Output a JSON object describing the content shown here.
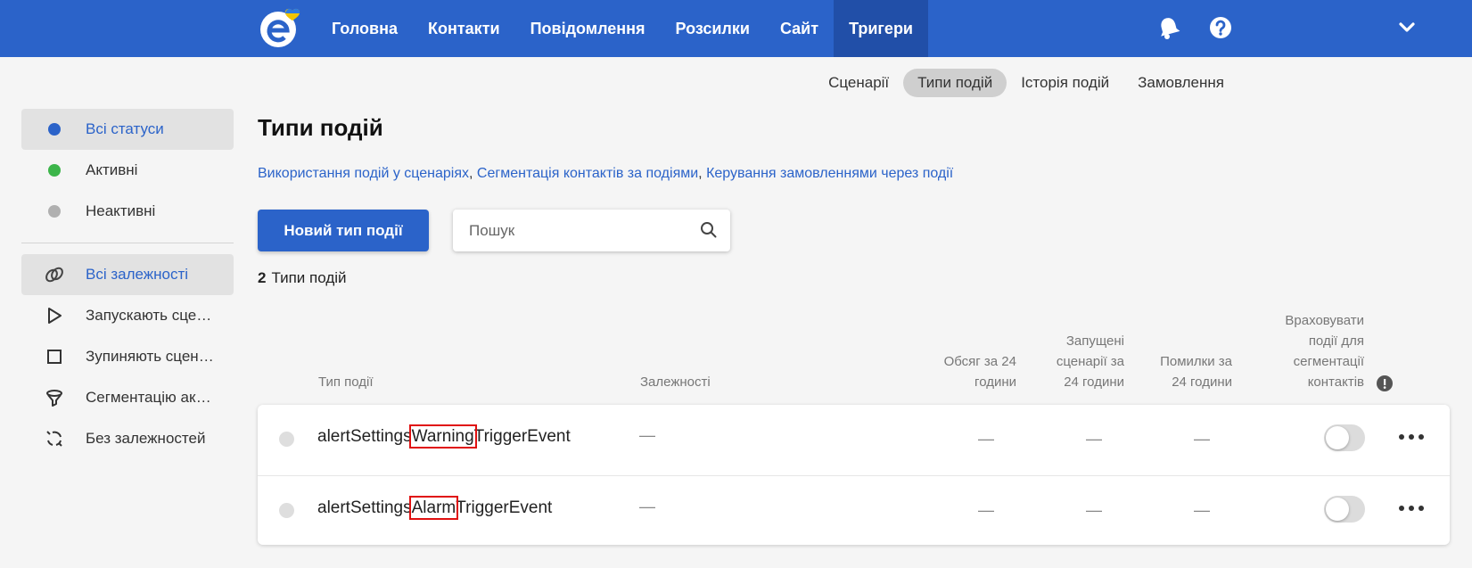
{
  "colors": {
    "brand": "#2b63c9",
    "active_status": "#3cb54a",
    "inactive_status": "#b0b0b0"
  },
  "nav": {
    "items": [
      {
        "label": "Головна"
      },
      {
        "label": "Контакти"
      },
      {
        "label": "Повідомлення"
      },
      {
        "label": "Розсилки"
      },
      {
        "label": "Сайт"
      },
      {
        "label": "Тригери",
        "active": true
      }
    ],
    "icons": [
      "bell-icon",
      "help-icon",
      "chevron-down-icon"
    ]
  },
  "subtabs": [
    {
      "label": "Сценарії"
    },
    {
      "label": "Типи подій",
      "active": true
    },
    {
      "label": "Історія подій"
    },
    {
      "label": "Замовлення"
    }
  ],
  "sidebar": {
    "statuses": [
      {
        "label": "Всі статуси",
        "active": true
      },
      {
        "label": "Активні"
      },
      {
        "label": "Неактивні"
      }
    ],
    "dependencies": [
      {
        "label": "Всі залежності",
        "icon": "link-icon",
        "active": true
      },
      {
        "label": "Запускають сценарії",
        "icon": "play-icon"
      },
      {
        "label": "Зупиняють сценарії",
        "icon": "stop-icon"
      },
      {
        "label": "Сегментацію акаунта",
        "icon": "filter-icon"
      },
      {
        "label": "Без залежностей",
        "icon": "broken-link-icon"
      }
    ]
  },
  "main": {
    "title": "Типи подій",
    "links": [
      "Використання подій у сценаріях",
      "Сегментація контактів за подіями",
      "Керування замовленнями через події"
    ],
    "link_separator": ",",
    "new_button": "Новий тип події",
    "search": {
      "placeholder": "Пошук",
      "value": ""
    },
    "count": {
      "number": "2",
      "label": "Типи подій"
    }
  },
  "table": {
    "headers": {
      "type": "Тип події",
      "deps": "Залежності",
      "volume_1": "Обсяг за 24",
      "volume_2": "години",
      "launched_1": "Запущені",
      "launched_2": "сценарії за",
      "launched_3": "24 години",
      "errors_1": "Помилки за",
      "errors_2": "24 години",
      "seg_1": "Враховувати",
      "seg_2": "події для",
      "seg_3": "сегментації",
      "seg_4": "контактів"
    },
    "rows": [
      {
        "prefix": "alertSettings",
        "highlight": "Warning",
        "suffix": "TriggerEvent",
        "deps": "—",
        "volume": "—",
        "launched": "—",
        "errors": "—",
        "segmentation": false,
        "status": "inactive"
      },
      {
        "prefix": "alertSettings",
        "highlight": "Alarm",
        "suffix": "TriggerEvent",
        "deps": "—",
        "volume": "—",
        "launched": "—",
        "errors": "—",
        "segmentation": false,
        "status": "inactive"
      }
    ]
  }
}
